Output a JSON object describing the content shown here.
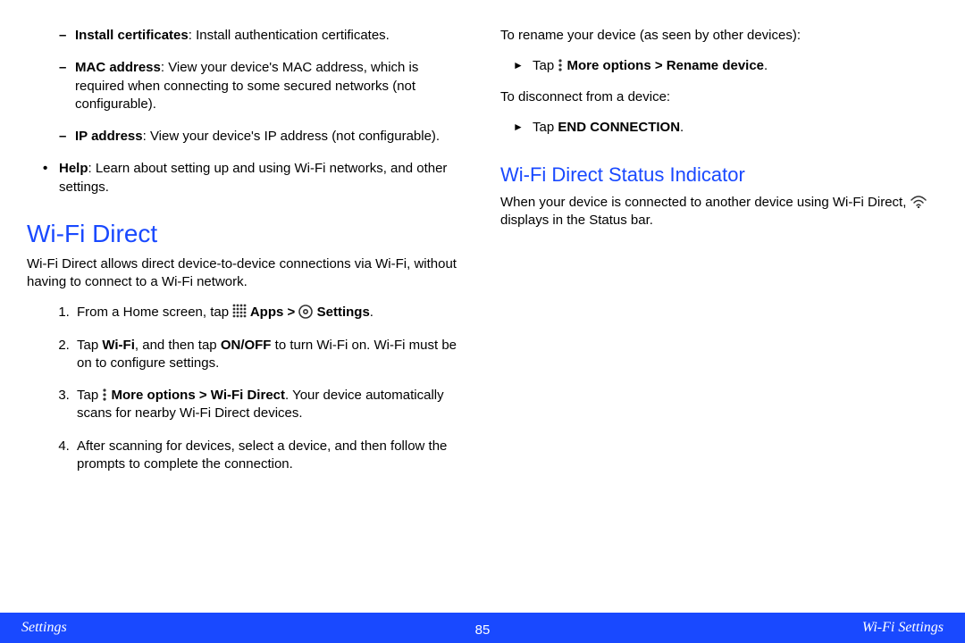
{
  "left": {
    "sublist": [
      {
        "label": "Install certificates",
        "desc": ": Install authentication certificates."
      },
      {
        "label": "MAC address",
        "desc": ": View your device's MAC address, which is required when connecting to some secured networks (not configurable)."
      },
      {
        "label": "IP address",
        "desc": ": View your device's IP address (not configurable)."
      }
    ],
    "mainlist": [
      {
        "label": "Help",
        "desc": ": Learn about setting up and using Wi-Fi networks, and other settings."
      }
    ],
    "section_title": "Wi-Fi Direct",
    "section_intro": "Wi-Fi Direct allows direct device-to-device connections via Wi-Fi, without having to connect to a Wi-Fi network.",
    "steps": {
      "s1_pre": "From a Home screen, tap ",
      "s1_apps": " Apps ",
      "s1_gt": ">",
      "s1_settings": " Settings",
      "s1_end": ".",
      "s2_pre": "Tap ",
      "s2_wifi": "Wi-Fi",
      "s2_mid": ", and then tap ",
      "s2_onoff": "ON/OFF",
      "s2_end": " to turn Wi-Fi on. Wi-Fi must be on to configure settings.",
      "s3_pre": "Tap ",
      "s3_more": " More options ",
      "s3_gt": ">",
      "s3_wfd": " Wi-Fi Direct",
      "s3_end": ". Your device automatically scans for nearby Wi-Fi Direct devices.",
      "s4": "After scanning for devices, select a device, and then follow the prompts to complete the connection."
    }
  },
  "right": {
    "rename_intro": "To rename your device (as seen by other devices):",
    "rename_step_pre": "Tap ",
    "rename_more": " More options ",
    "rename_gt": ">",
    "rename_dev": " Rename device",
    "rename_end": ".",
    "disconnect_intro": "To disconnect from a device:",
    "disconnect_step_pre": "Tap ",
    "disconnect_cmd": "END CONNECTION",
    "disconnect_end": ".",
    "subsection_title": "Wi-Fi Direct Status Indicator",
    "status_text_pre": "When your device is connected to another device using Wi-Fi Direct, ",
    "status_text_post": " displays in the Status bar."
  },
  "footer": {
    "left": "Settings",
    "center": "85",
    "right": "Wi-Fi Settings"
  }
}
